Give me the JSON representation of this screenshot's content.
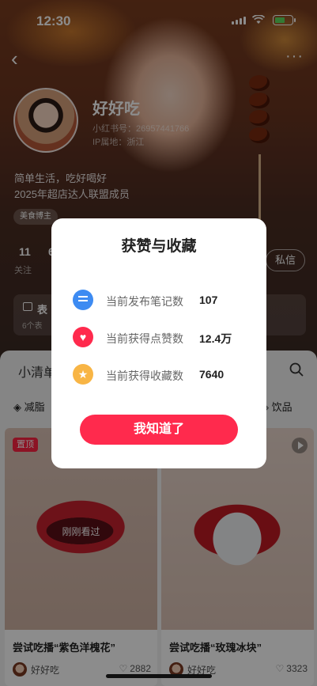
{
  "status_bar": {
    "time": "12:30"
  },
  "profile": {
    "nickname": "好好吃",
    "uid": "小红书号：26957441766",
    "ip_location": "IP属地：浙江",
    "bio_line1": "简单生活，吃好喝好",
    "bio_line2": "2025年超店达人联盟成员",
    "tag": "美食博主",
    "following_count": "11",
    "followers_count_partial": "6",
    "following_label": "关注",
    "message_button": "私信"
  },
  "emoji_card": {
    "title": "表",
    "subtitle": "6个表"
  },
  "content": {
    "search_label": "小清单",
    "filter_left": "减脂",
    "filter_right": "饮品"
  },
  "cards": [
    {
      "pinned": "置顶",
      "overlay_text": "刚刚看过",
      "title": "尝试吃播“紫色洋槐花”",
      "author": "好好吃",
      "likes": "2882"
    },
    {
      "title": "尝试吃播“玫瑰冰块”",
      "author": "好好吃",
      "likes": "3323"
    }
  ],
  "modal": {
    "title": "获赞与收藏",
    "rows": [
      {
        "label": "当前发布笔记数",
        "value": "107",
        "icon": "note-icon",
        "color": "#3d8bf2"
      },
      {
        "label": "当前获得点赞数",
        "value": "12.4万",
        "icon": "heart-icon",
        "color": "#ff2a4d"
      },
      {
        "label": "当前获得收藏数",
        "value": "7640",
        "icon": "star-icon",
        "color": "#f8b545"
      }
    ],
    "ok_button": "我知道了"
  },
  "colors": {
    "accent": "#ff2a4d",
    "pin_badge": "#ff2442"
  }
}
